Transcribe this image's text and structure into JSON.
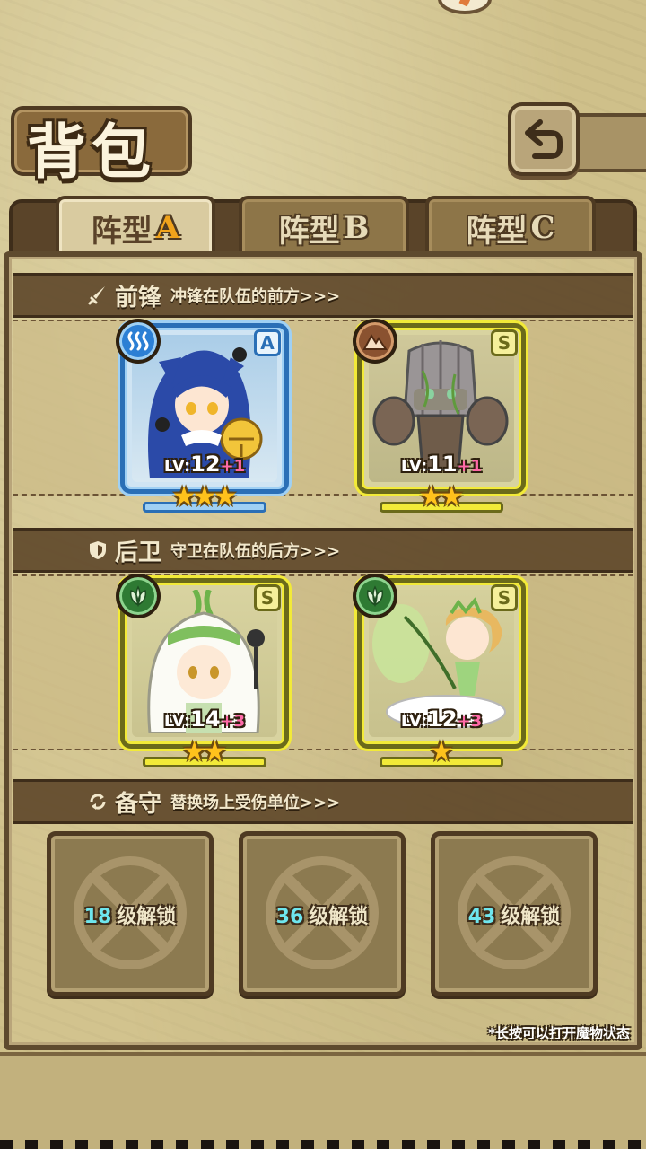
{
  "title": "背包",
  "back_button": {
    "icon": "return-arrow-icon"
  },
  "tabs": [
    {
      "prefix": "阵型",
      "suffix": "A",
      "active": true
    },
    {
      "prefix": "阵型",
      "suffix": "B",
      "active": false
    },
    {
      "prefix": "阵型",
      "suffix": "C",
      "active": false
    }
  ],
  "sections": {
    "front": {
      "icon": "sword-icon",
      "title": "前锋",
      "subtitle": "冲锋在队伍的前方>>>"
    },
    "rear": {
      "icon": "shield-icon",
      "title": "后卫",
      "subtitle": "守卫在队伍的后方>>>"
    },
    "reserve": {
      "icon": "swap-arrows-icon",
      "title": "备守",
      "subtitle": "替换场上受伤单位>>>"
    }
  },
  "units": [
    {
      "element": "water-icon",
      "rank": "A",
      "lv_prefix": "LV:",
      "level": "12",
      "plus": "+1",
      "stars": 3,
      "accent": "#2a6fb6"
    },
    {
      "element": "earth-icon",
      "rank": "S",
      "lv_prefix": "LV:",
      "level": "11",
      "plus": "+1",
      "stars": 2,
      "accent": "#f2ea38"
    },
    {
      "element": "nature-icon",
      "rank": "S",
      "lv_prefix": "LV:",
      "level": "14",
      "plus": "+3",
      "stars": 2,
      "accent": "#f2ea38"
    },
    {
      "element": "nature-icon",
      "rank": "S",
      "lv_prefix": "LV:",
      "level": "12",
      "plus": "+3",
      "stars": 1,
      "accent": "#f2ea38"
    }
  ],
  "reserve_slots": [
    {
      "level": "18",
      "label": "级解锁"
    },
    {
      "level": "36",
      "label": "级解锁"
    },
    {
      "level": "43",
      "label": "级解锁"
    }
  ],
  "hint": "*长按可以打开魔物状态"
}
